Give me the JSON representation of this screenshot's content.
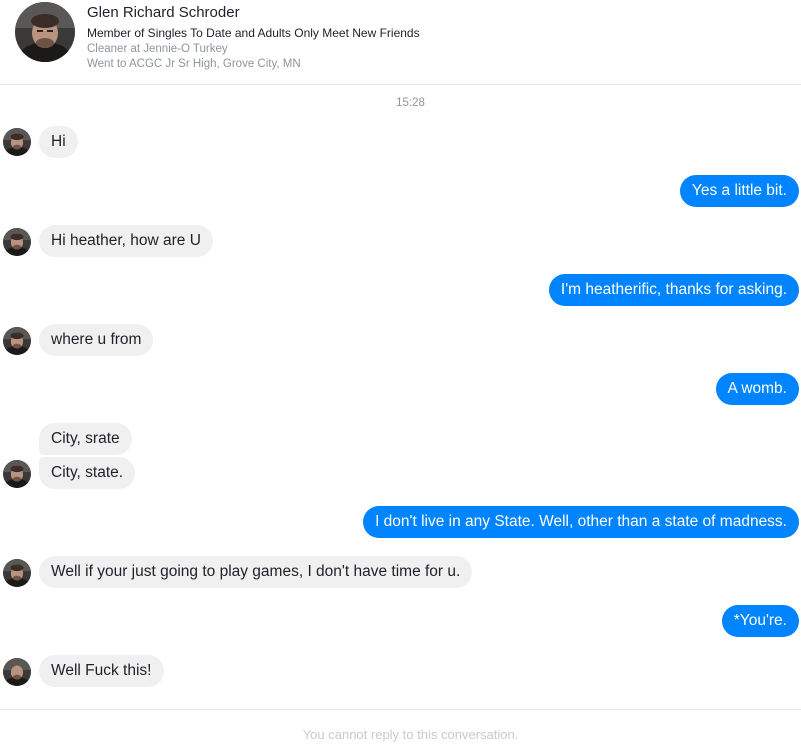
{
  "profile": {
    "name": "Glen Richard Schroder",
    "group": "Member of Singles To Date and Adults Only Meet New Friends",
    "work": "Cleaner at Jennie-O Turkey",
    "education": "Went to ACGC Jr Sr High, Grove City, MN",
    "avatar_icon": "profile-photo"
  },
  "conversation": {
    "timestamp": "15:28",
    "messages": [
      {
        "from": "them",
        "text": "Hi"
      },
      {
        "from": "me",
        "text": "Yes a little bit."
      },
      {
        "from": "them",
        "text": "Hi heather, how are U"
      },
      {
        "from": "me",
        "text": "I'm heatherific, thanks for asking."
      },
      {
        "from": "them",
        "text": "where u from"
      },
      {
        "from": "me",
        "text": "A womb."
      },
      {
        "from": "them",
        "text": "City, srate"
      },
      {
        "from": "them",
        "text": "City, state."
      },
      {
        "from": "me",
        "text": "I don't live in any State. Well, other than a state of madness."
      },
      {
        "from": "them",
        "text": "Well if your just going to play games, I don't have time for u."
      },
      {
        "from": "me",
        "text": "*You're."
      },
      {
        "from": "them",
        "text": "Well Fuck this!"
      }
    ]
  },
  "footer": {
    "notice": "You cannot reply to this conversation."
  },
  "colors": {
    "outgoing_bubble": "#0084ff",
    "incoming_bubble": "#f1f0f0"
  }
}
